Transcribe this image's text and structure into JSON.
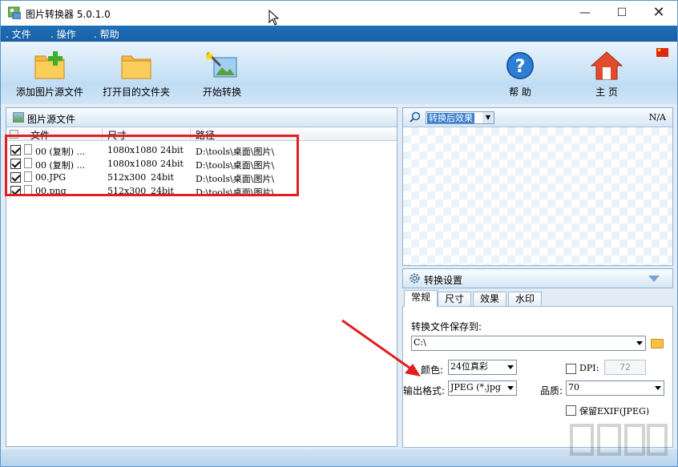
{
  "window": {
    "title": "图片转换器 5.0.1.0",
    "min": "—",
    "max": "☐",
    "close": "✕"
  },
  "menu": [
    ". 文件",
    ". 操作",
    ". 帮助"
  ],
  "toolbar": {
    "add_source": "添加图片源文件",
    "open_target": "打开目的文件夹",
    "start_convert": "开始转换",
    "help": "帮 助",
    "home": "主 页"
  },
  "source_panel": {
    "title": "图片源文件",
    "columns": [
      "文件",
      "尺寸",
      "路径"
    ],
    "rows": [
      {
        "name": "00 (复制) ...",
        "size": "1080x1080",
        "depth": "24bit",
        "path": "D:\\tools\\桌面\\图片\\"
      },
      {
        "name": "00 (复制) ...",
        "size": "1080x1080",
        "depth": "24bit",
        "path": "D:\\tools\\桌面\\图片\\"
      },
      {
        "name": "00.JPG",
        "size": "512x300",
        "depth": "24bit",
        "path": "D:\\tools\\桌面\\图片\\"
      },
      {
        "name": "00.png",
        "size": "512x300",
        "depth": "24bit",
        "path": "D:\\tools\\桌面\\图片\\"
      }
    ]
  },
  "preview": {
    "mode": "转换后效果",
    "status": "N/A"
  },
  "settings": {
    "title": "转换设置",
    "tabs": [
      "常规",
      "尺寸",
      "效果",
      "水印"
    ],
    "save_to_label": "转换文件保存到:",
    "save_to_value": "C:\\",
    "color_label": "颜色:",
    "color_value": "24位真彩",
    "dpi_label": "DPI:",
    "dpi_value": "72",
    "format_label": "输出格式:",
    "format_value": "JPEG (*.jpg",
    "quality_label": "品质:",
    "quality_value": "70",
    "exif_label": "保留EXIF(JPEG)"
  },
  "colors": {
    "accent_blue": "#1f6fb8",
    "highlight_red": "#e02020"
  }
}
